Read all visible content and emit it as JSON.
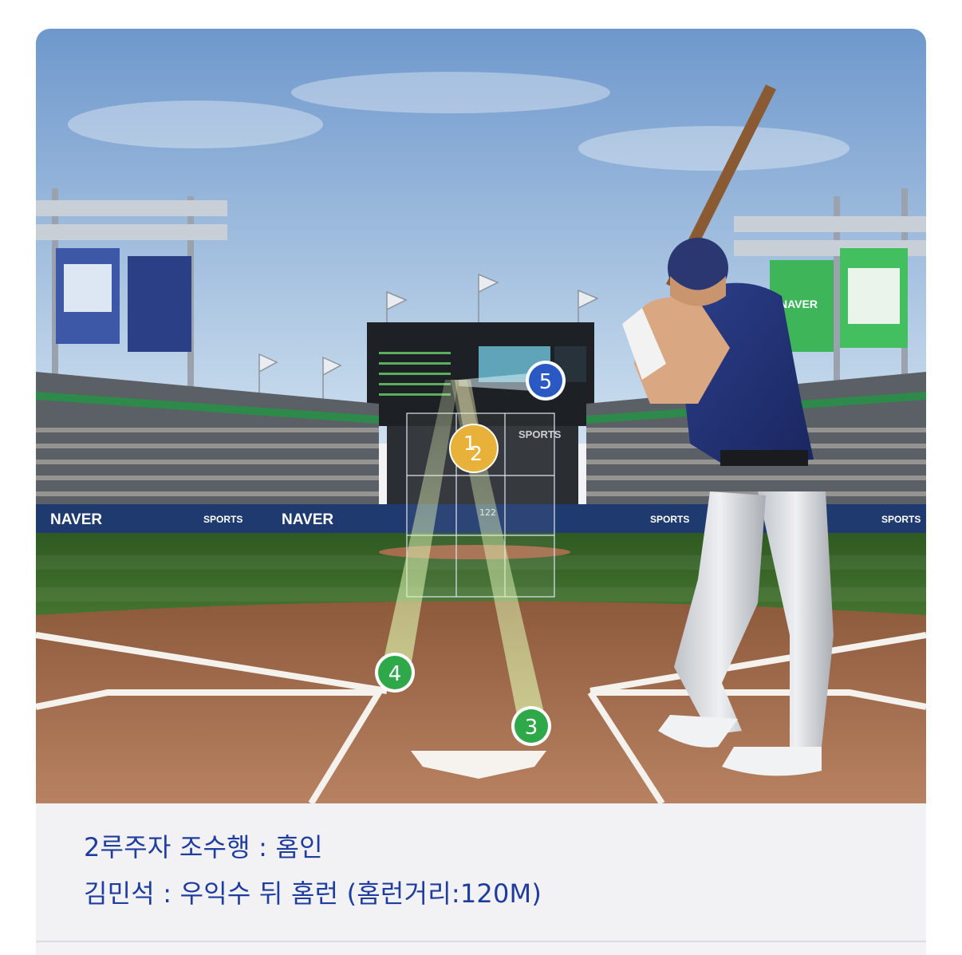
{
  "scene": {
    "board_brand": "NAVER",
    "board_sports": "SPORTS",
    "field_distance": "122"
  },
  "pitch_markers": [
    {
      "number": "1",
      "color": "#e8b23a"
    },
    {
      "number": "2",
      "color": "#e8b23a"
    },
    {
      "number": "3",
      "color": "#2fa84a"
    },
    {
      "number": "4",
      "color": "#2fa84a"
    },
    {
      "number": "5",
      "color": "#2a59c4"
    }
  ],
  "caption": {
    "line1": "2루주자 조수행 : 홈인",
    "line2": "김민석 : 우익수 뒤 홈런 (홈런거리:120M)"
  },
  "colors": {
    "caption_text": "#1f3d9e",
    "sky": "#8fb3da",
    "grass": "#3b6b2c",
    "dirt": "#a56f4c"
  }
}
